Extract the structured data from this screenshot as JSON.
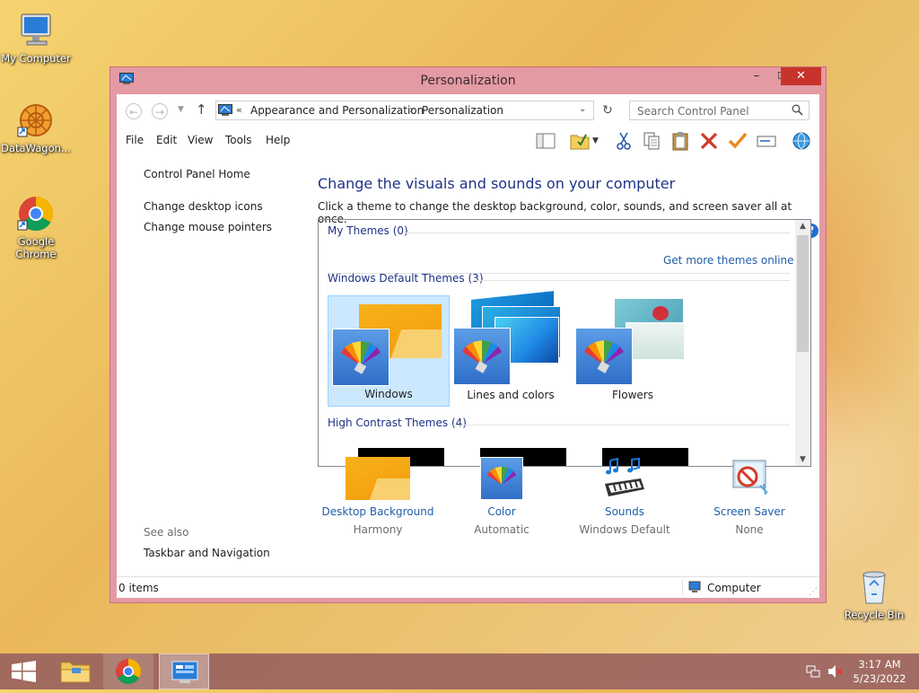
{
  "desktop": {
    "icons": [
      {
        "label": "My Computer",
        "icon": "computer-icon"
      },
      {
        "label": "DataWagon...",
        "icon": "datawagon-icon"
      },
      {
        "label": "Google Chrome",
        "icon": "chrome-icon"
      },
      {
        "label": "Recycle Bin",
        "icon": "recycle-bin-icon"
      }
    ]
  },
  "window": {
    "title": "Personalization",
    "controls": {
      "minimize": "–",
      "maximize": "☐",
      "close": "✕"
    }
  },
  "address": {
    "chevrons": "«",
    "crumbs": [
      "Appearance and Personalization",
      "Personalization"
    ],
    "separator": "›"
  },
  "search": {
    "placeholder": "Search Control Panel",
    "value": ""
  },
  "menu": [
    "File",
    "Edit",
    "View",
    "Tools",
    "Help"
  ],
  "left": {
    "home": "Control Panel Home",
    "links": [
      "Change desktop icons",
      "Change mouse pointers"
    ],
    "see_also_label": "See also",
    "see_also": [
      "Taskbar and Navigation"
    ]
  },
  "main": {
    "heading": "Change the visuals and sounds on your computer",
    "subheading": "Click a theme to change the desktop background, color, sounds, and screen saver all at once.",
    "my_themes": "My Themes (0)",
    "get_more": "Get more themes online",
    "default_group": "Windows Default Themes (3)",
    "themes": [
      "Windows",
      "Lines and colors",
      "Flowers"
    ],
    "selected_theme": "Windows",
    "hc_group": "High Contrast Themes (4)"
  },
  "settings": [
    {
      "label": "Desktop Background",
      "value": "Harmony",
      "icon": "desktop-background-icon"
    },
    {
      "label": "Color",
      "value": "Automatic",
      "icon": "color-icon"
    },
    {
      "label": "Sounds",
      "value": "Windows Default",
      "icon": "sounds-icon"
    },
    {
      "label": "Screen Saver",
      "value": "None",
      "icon": "screen-saver-icon"
    }
  ],
  "status": {
    "items": "0 items",
    "zone": "Computer"
  },
  "taskbar": {
    "time": "3:17 AM",
    "date": "5/23/2022"
  },
  "colors": {
    "title_bar": "#e49aa3",
    "close": "#c7342b",
    "link": "#1f5ea8",
    "heading": "#1e3287"
  }
}
